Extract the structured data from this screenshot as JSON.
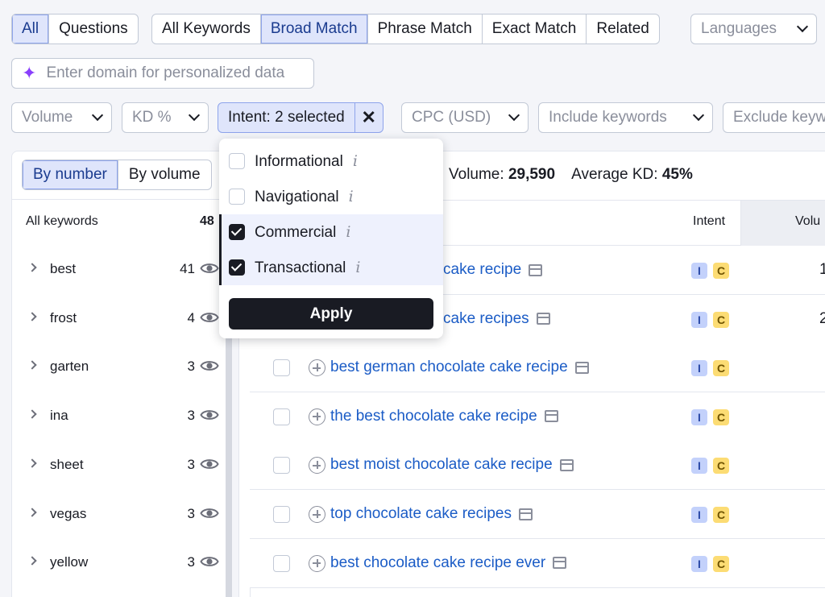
{
  "match_tabs": {
    "all": "All",
    "questions": "Questions",
    "all_keywords": "All Keywords",
    "broad_match": "Broad Match",
    "phrase_match": "Phrase Match",
    "exact_match": "Exact Match",
    "related": "Related"
  },
  "languages_placeholder": "Languages",
  "domain_placeholder": "Enter domain for personalized data",
  "filters": {
    "volume": "Volume",
    "kd": "KD %",
    "intent": "Intent: 2 selected",
    "cpc": "CPC (USD)",
    "include": "Include keywords",
    "exclude": "Exclude keyw"
  },
  "intent_popup": {
    "options": [
      {
        "label": "Informational",
        "checked": false
      },
      {
        "label": "Navigational",
        "checked": false
      },
      {
        "label": "Commercial",
        "checked": true
      },
      {
        "label": "Transactional",
        "checked": true
      }
    ],
    "apply_label": "Apply"
  },
  "group_toggle": {
    "by_number": "By number",
    "by_volume": "By volume"
  },
  "summary": {
    "volume_label": "Volume:",
    "volume_value": "29,590",
    "kd_label": "Average KD:",
    "kd_value": "45%"
  },
  "groups": {
    "all_label": "All keywords",
    "all_count": "48",
    "items": [
      {
        "name": "best",
        "count": "41"
      },
      {
        "name": "frost",
        "count": "4"
      },
      {
        "name": "garten",
        "count": "3"
      },
      {
        "name": "ina",
        "count": "3"
      },
      {
        "name": "sheet",
        "count": "3"
      },
      {
        "name": "vegas",
        "count": "3"
      },
      {
        "name": "yellow",
        "count": "3"
      }
    ]
  },
  "table": {
    "headers": {
      "intent": "Intent",
      "volume": "Volu"
    },
    "rows": [
      {
        "keyword": "cake recipe",
        "intent": [
          "I",
          "C"
        ],
        "volume": "1"
      },
      {
        "keyword": "cake recipes",
        "intent": [
          "I",
          "C"
        ],
        "volume": "2"
      },
      {
        "keyword": "best german chocolate cake recipe",
        "intent": [
          "I",
          "C"
        ],
        "volume": ""
      },
      {
        "keyword": "the best chocolate cake recipe",
        "intent": [
          "I",
          "C"
        ],
        "volume": ""
      },
      {
        "keyword": "best moist chocolate cake recipe",
        "intent": [
          "I",
          "C"
        ],
        "volume": ""
      },
      {
        "keyword": "top chocolate cake recipes",
        "intent": [
          "I",
          "C"
        ],
        "volume": ""
      },
      {
        "keyword": "best chocolate cake recipe ever",
        "intent": [
          "I",
          "C"
        ],
        "volume": ""
      }
    ]
  },
  "icons": {
    "sparkle": "sparkle-icon",
    "chevron": "chevron-down-icon",
    "close": "close-icon",
    "eye": "eye-icon",
    "plus": "add-keyword-icon",
    "serp": "serp-icon",
    "info": "info-icon"
  }
}
